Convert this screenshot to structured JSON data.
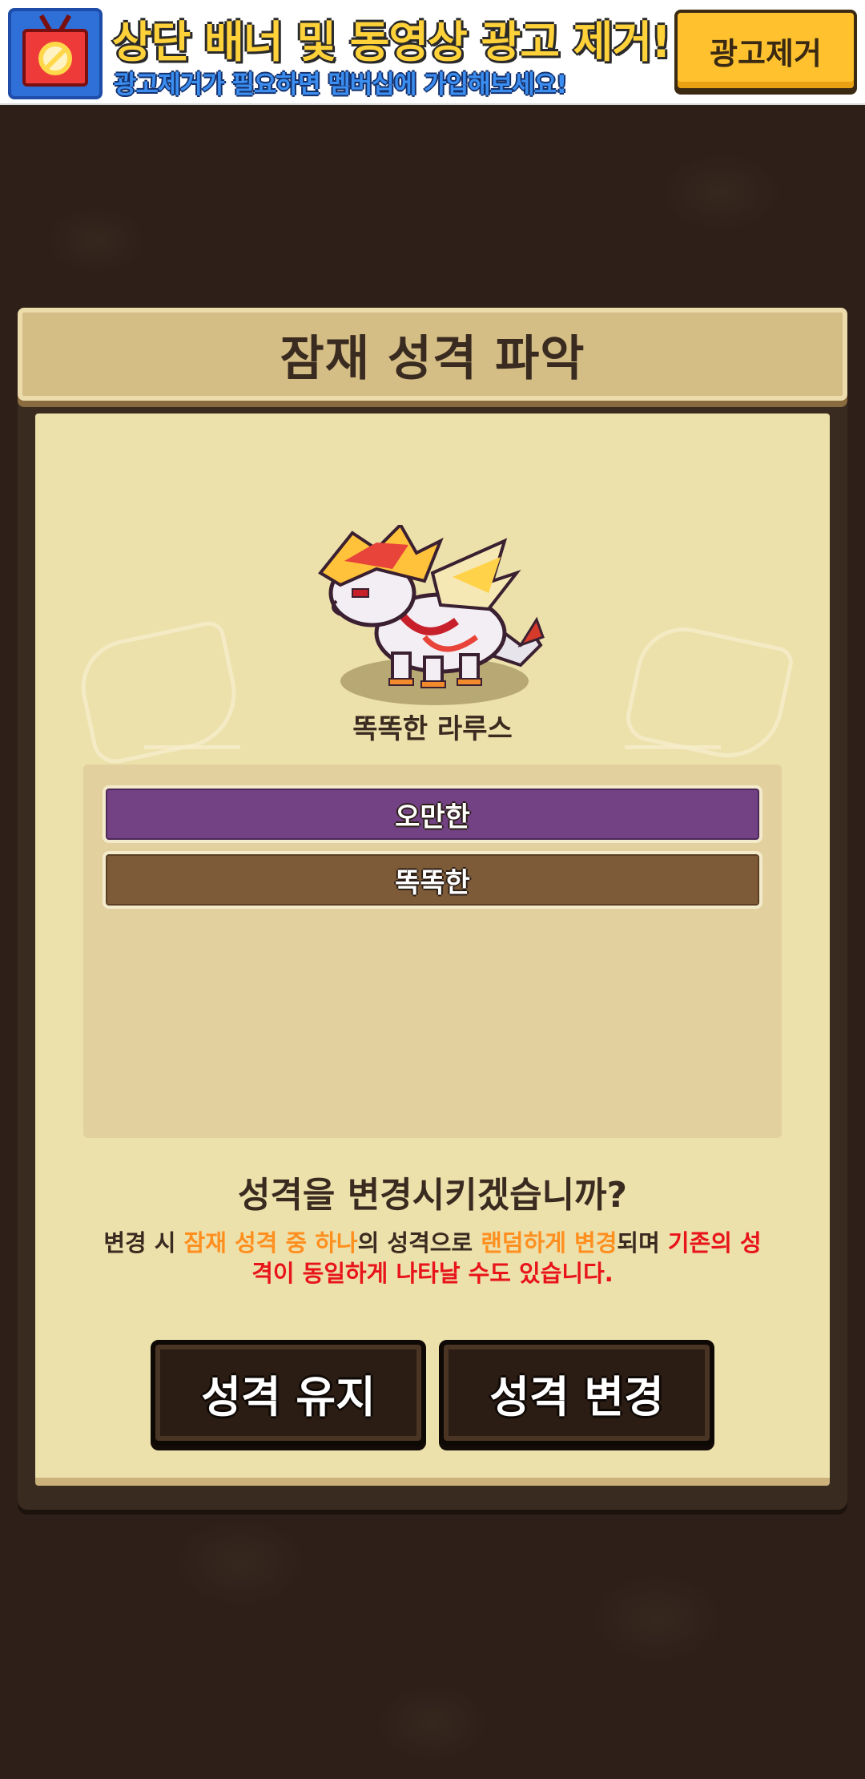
{
  "ad_banner": {
    "title": "상단 배너 및 동영상 광고 제거!",
    "subtitle": "광고제거가 필요하면 멤버십에 가입해보세요!",
    "remove_button_label": "광고제거",
    "icon": "no-ads-tv-icon"
  },
  "dialog": {
    "title": "잠재 성격 파악",
    "pet": {
      "name": "똑똑한 라루스",
      "icon": "dragon-pet-sprite"
    },
    "traits": [
      {
        "label": "오만한",
        "selected": true,
        "color": "#724284"
      },
      {
        "label": "똑똑한",
        "selected": false,
        "color": "#7d5b38"
      }
    ],
    "question": "성격을 변경시키겠습니까?",
    "description": {
      "part1": "변경 시 ",
      "part2": "잠재 성격 중 하나",
      "part3": "의 성격으로 ",
      "part4": "랜덤하게 변경",
      "part5": "되며 ",
      "part6": "기존의 성격이 동일하게 나타날 수도 있습니다."
    },
    "buttons": {
      "keep": "성격 유지",
      "change": "성격 변경"
    }
  },
  "colors": {
    "accent_orange": "#ff8f1f",
    "warning_red": "#e8141a",
    "ad_button": "#ffc22e"
  }
}
